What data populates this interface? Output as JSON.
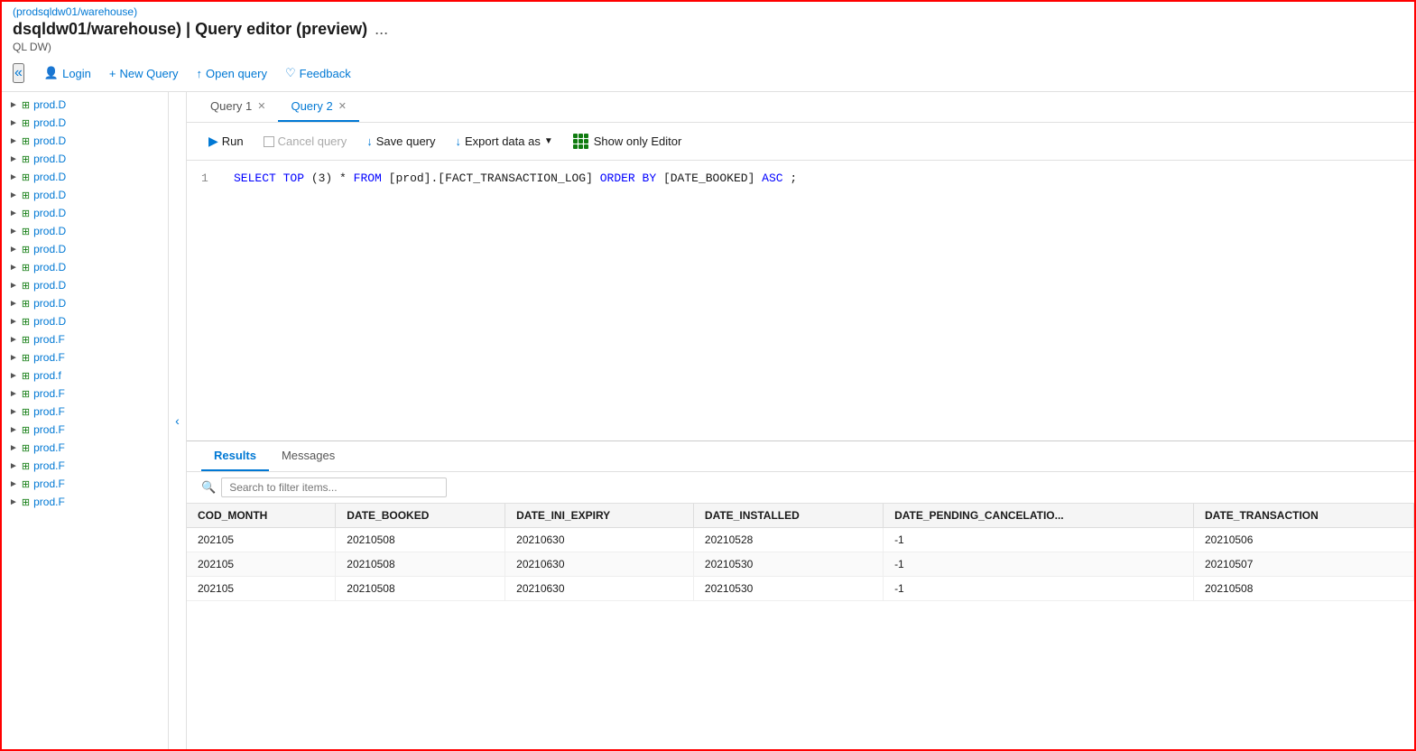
{
  "breadcrumb_top": "(prodsqldw01/warehouse)",
  "page_title": "dsqldw01/warehouse) | Query editor (preview)",
  "ellipsis": "...",
  "subtitle": "QL DW)",
  "toolbar": {
    "collapse_label": "«",
    "login_label": "Login",
    "new_query_label": "New Query",
    "open_query_label": "Open query",
    "feedback_label": "Feedback"
  },
  "tabs": [
    {
      "label": "Query 1",
      "active": false
    },
    {
      "label": "Query 2",
      "active": true
    }
  ],
  "query_toolbar": {
    "run_label": "Run",
    "cancel_label": "Cancel query",
    "save_label": "Save query",
    "export_label": "Export data as",
    "show_editor_label": "Show only Editor"
  },
  "code": {
    "line_num": "1",
    "text": "SELECT TOP (3) * FROM [prod].[FACT_TRANSACTION_LOG] ORDER BY [DATE_BOOKED] ASC;"
  },
  "sidebar_items": [
    "prod.D",
    "prod.D",
    "prod.D",
    "prod.D",
    "prod.D",
    "prod.D",
    "prod.D",
    "prod.D",
    "prod.D",
    "prod.D",
    "prod.D",
    "prod.D",
    "prod.D",
    "prod.F",
    "prod.F",
    "prod.f",
    "prod.F",
    "prod.F",
    "prod.F",
    "prod.F",
    "prod.F",
    "prod.F",
    "prod.F"
  ],
  "results": {
    "tabs": [
      "Results",
      "Messages"
    ],
    "active_tab": "Results",
    "search_placeholder": "Search to filter items...",
    "columns": [
      "COD_MONTH",
      "DATE_BOOKED",
      "DATE_INI_EXPIRY",
      "DATE_INSTALLED",
      "DATE_PENDING_CANCELATIO...",
      "DATE_TRANSACTION"
    ],
    "rows": [
      [
        "202105",
        "20210508",
        "20210630",
        "20210528",
        "-1",
        "20210506"
      ],
      [
        "202105",
        "20210508",
        "20210630",
        "20210530",
        "-1",
        "20210507"
      ],
      [
        "202105",
        "20210508",
        "20210630",
        "20210530",
        "-1",
        "20210508"
      ]
    ]
  }
}
